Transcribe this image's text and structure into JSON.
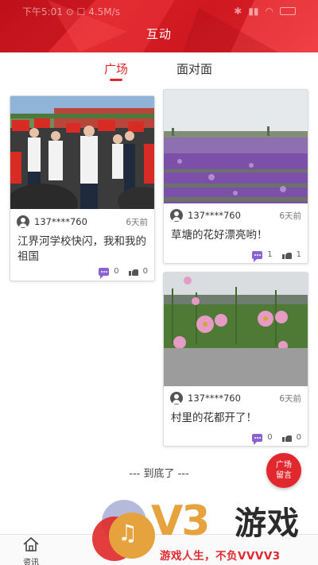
{
  "status_bar": {
    "time": "下午5:01",
    "network": "4.5M/s"
  },
  "header": {
    "title": "互动"
  },
  "tabs": [
    {
      "label": "广场",
      "active": true
    },
    {
      "label": "面对面",
      "active": false
    }
  ],
  "posts": [
    {
      "user": "137****760",
      "time": "6天前",
      "text": "江界河学校快闪，我和我的祖国",
      "comments": "0",
      "likes": "0"
    },
    {
      "user": "137****760",
      "time": "6天前",
      "text": "草塘的花好漂亮哟！",
      "comments": "1",
      "likes": "1"
    },
    {
      "user": "137****760",
      "time": "6天前",
      "text": "村里的花都开了！",
      "comments": "0",
      "likes": "0"
    }
  ],
  "end_text": "--- 到底了 ---",
  "fab": {
    "line1": "广场",
    "line2": "留言"
  },
  "bottom_nav": [
    {
      "label": "资讯",
      "icon": "home-icon"
    }
  ],
  "watermark": {
    "logo": "V3",
    "name": "游戏",
    "slogan": "游戏人生，不负VVVV3"
  },
  "colors": {
    "accent": "#e0282e",
    "header": "#d41a22",
    "comment": "#8a63d2"
  }
}
